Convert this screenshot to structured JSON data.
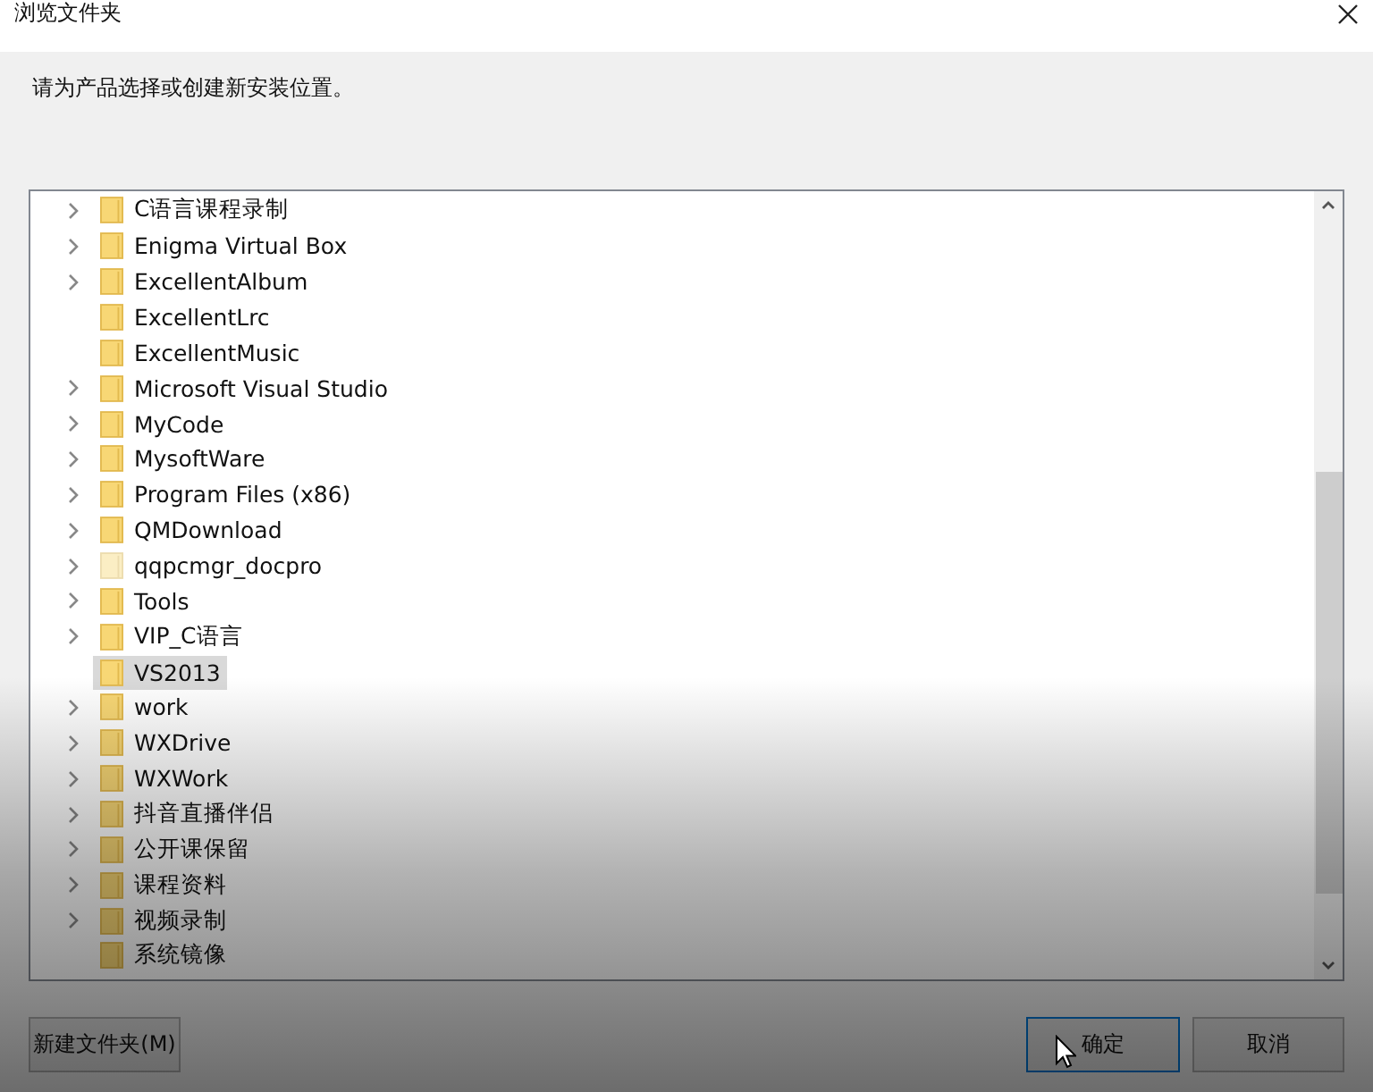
{
  "window": {
    "title": "浏览文件夹"
  },
  "prompt": "请为产品选择或创建新安装位置。",
  "tree": {
    "items": [
      {
        "label": "C语言课程录制",
        "expandable": true,
        "selected": false,
        "faded": false
      },
      {
        "label": "Enigma Virtual Box",
        "expandable": true,
        "selected": false,
        "faded": false
      },
      {
        "label": "ExcellentAlbum",
        "expandable": true,
        "selected": false,
        "faded": false
      },
      {
        "label": "ExcellentLrc",
        "expandable": false,
        "selected": false,
        "faded": false
      },
      {
        "label": "ExcellentMusic",
        "expandable": false,
        "selected": false,
        "faded": false
      },
      {
        "label": "Microsoft Visual Studio",
        "expandable": true,
        "selected": false,
        "faded": false
      },
      {
        "label": "MyCode",
        "expandable": true,
        "selected": false,
        "faded": false
      },
      {
        "label": "MysoftWare",
        "expandable": true,
        "selected": false,
        "faded": false
      },
      {
        "label": "Program Files (x86)",
        "expandable": true,
        "selected": false,
        "faded": false
      },
      {
        "label": "QMDownload",
        "expandable": true,
        "selected": false,
        "faded": false
      },
      {
        "label": "qqpcmgr_docpro",
        "expandable": true,
        "selected": false,
        "faded": true
      },
      {
        "label": "Tools",
        "expandable": true,
        "selected": false,
        "faded": false
      },
      {
        "label": "VIP_C语言",
        "expandable": true,
        "selected": false,
        "faded": false
      },
      {
        "label": "VS2013",
        "expandable": false,
        "selected": true,
        "faded": false
      },
      {
        "label": "work",
        "expandable": true,
        "selected": false,
        "faded": false
      },
      {
        "label": "WXDrive",
        "expandable": true,
        "selected": false,
        "faded": false
      },
      {
        "label": "WXWork",
        "expandable": true,
        "selected": false,
        "faded": false
      },
      {
        "label": "抖音直播伴侣",
        "expandable": true,
        "selected": false,
        "faded": false
      },
      {
        "label": "公开课保留",
        "expandable": true,
        "selected": false,
        "faded": false
      },
      {
        "label": "课程资料",
        "expandable": true,
        "selected": false,
        "faded": false
      },
      {
        "label": "视频录制",
        "expandable": true,
        "selected": false,
        "faded": false
      },
      {
        "label": "系统镜像",
        "expandable": false,
        "selected": false,
        "faded": false
      }
    ]
  },
  "buttons": [
    {
      "label": "新建文件夹(M)",
      "kind": "secondary"
    },
    {
      "label": "确定",
      "kind": "default"
    },
    {
      "label": "取消",
      "kind": "secondary"
    }
  ]
}
